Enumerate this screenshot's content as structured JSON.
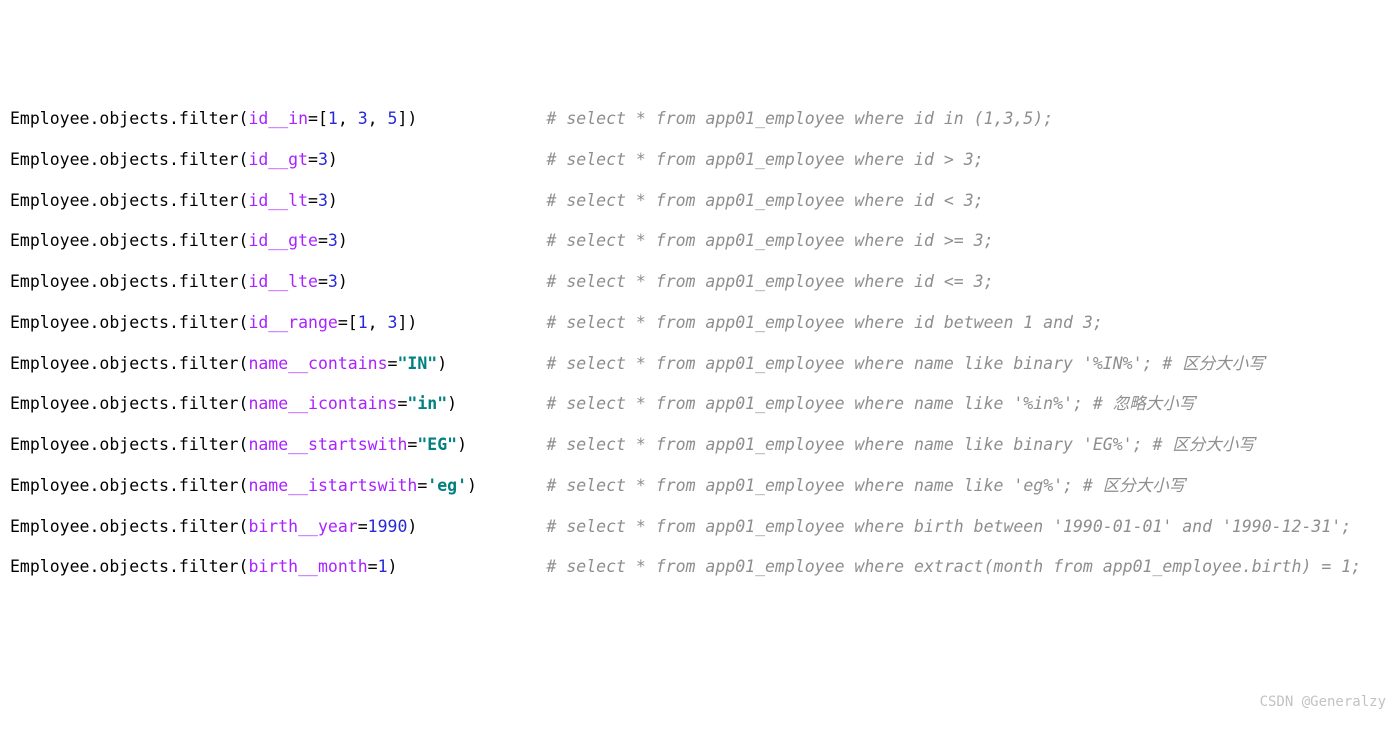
{
  "cls": "Employee",
  "chain": ".objects.filter(",
  "close": ")",
  "lines": [
    {
      "kw": "id__in",
      "argPre": "=[",
      "argMid": [
        "1",
        ", ",
        "3",
        ", ",
        "5"
      ],
      "argPost": "]",
      "comment": "# select * from app01_employee where id in (1,3,5);"
    },
    {
      "kw": "id__gt",
      "argPre": "=",
      "argMid": [
        "3"
      ],
      "argPost": "",
      "comment": "# select * from app01_employee where id > 3;"
    },
    {
      "kw": "id__lt",
      "argPre": "=",
      "argMid": [
        "3"
      ],
      "argPost": "",
      "comment": "# select * from app01_employee where id < 3;"
    },
    {
      "kw": "id__gte",
      "argPre": "=",
      "argMid": [
        "3"
      ],
      "argPost": "",
      "comment": "# select * from app01_employee where id >= 3;"
    },
    {
      "kw": "id__lte",
      "argPre": "=",
      "argMid": [
        "3"
      ],
      "argPost": "",
      "comment": "# select * from app01_employee where id <= 3;"
    },
    {
      "kw": "id__range",
      "argPre": "=[",
      "argMid": [
        "1",
        ", ",
        "3"
      ],
      "argPost": "]",
      "comment": "# select * from app01_employee where id between 1 and 3;"
    },
    {
      "kw": "name__contains",
      "argPre": "=",
      "str": "\"IN\"",
      "comment": "# select * from app01_employee where name like binary '%IN%'; # 区分大小写"
    },
    {
      "kw": "name__icontains",
      "argPre": "=",
      "str": "\"in\"",
      "comment": "# select * from app01_employee where name like '%in%'; # 忽略大小写"
    },
    {
      "kw": "name__startswith",
      "argPre": "=",
      "str": "\"EG\"",
      "comment": "# select * from app01_employee where name like binary 'EG%'; # 区分大小写"
    },
    {
      "kw": "name__istartswith",
      "argPre": "=",
      "str": "'eg'",
      "comment": "# select * from app01_employee where name like 'eg%'; # 区分大小写"
    },
    {
      "kw": "birth__year",
      "argPre": "=",
      "argMid": [
        "1990"
      ],
      "argPost": "",
      "comment": "# select * from app01_employee where birth between '1990-01-01' and '1990-12-31';"
    },
    {
      "kw": "birth__month",
      "argPre": "=",
      "argMid": [
        "1"
      ],
      "argPost": "",
      "comment": "# select * from app01_employee where extract(month from app01_employee.birth) = 1;"
    }
  ],
  "commentCol": 54,
  "watermark": "CSDN @Generalzy"
}
